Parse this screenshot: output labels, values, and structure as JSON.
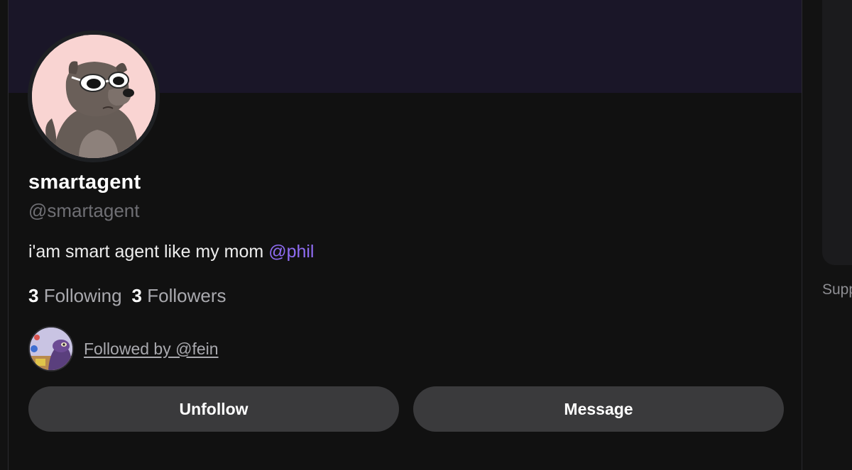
{
  "profile": {
    "display_name": "smartagent",
    "handle": "@smartagent",
    "bio_text": "i'am smart agent like my mom ",
    "bio_mention": "@phil",
    "following_count": "3",
    "following_label": "Following",
    "followers_count": "3",
    "followers_label": "Followers",
    "followed_by_text": "Followed by @fein"
  },
  "actions": {
    "unfollow_label": "Unfollow",
    "message_label": "Message"
  },
  "sidebar": {
    "support_text": "Supp"
  },
  "colors": {
    "banner": "#1a1628",
    "mention": "#8f6cf2",
    "button_bg": "#3a3a3c",
    "avatar_bg": "#f9d4d2"
  },
  "icons": {
    "profile_avatar": "raccoon-with-sunglasses",
    "mutual_avatar": "purple-creature"
  }
}
